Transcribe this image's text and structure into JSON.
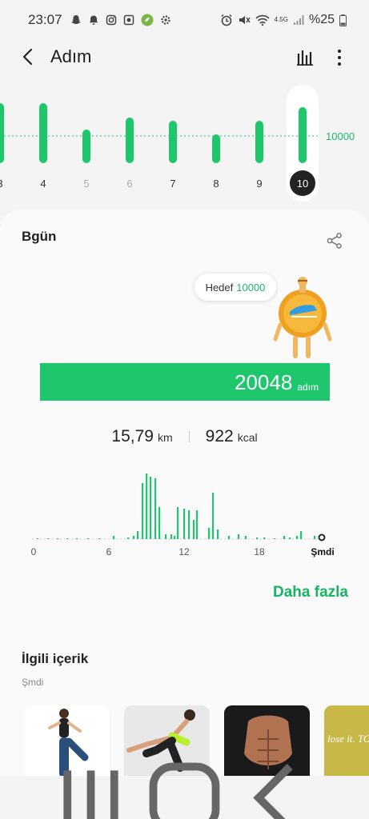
{
  "status_bar": {
    "time": "23:07",
    "battery": "%25",
    "network": "4.5G",
    "icons": [
      "snapchat-icon",
      "notification-bell-icon",
      "instagram-icon",
      "camera-icon",
      "app-icon",
      "settings-gear-icon"
    ],
    "right_icons": [
      "alarm-icon",
      "mute-icon",
      "wifi-icon",
      "signal-icon",
      "battery-icon"
    ]
  },
  "header": {
    "title": "Adım"
  },
  "week_chart": {
    "goal_label": "10000",
    "days": [
      {
        "label": "3",
        "value": 0.75,
        "selected": false,
        "dim": false
      },
      {
        "label": "4",
        "value": 0.75,
        "selected": false,
        "dim": false
      },
      {
        "label": "5",
        "value": 0.42,
        "selected": false,
        "dim": true
      },
      {
        "label": "6",
        "value": 0.57,
        "selected": false,
        "dim": true
      },
      {
        "label": "7",
        "value": 0.53,
        "selected": false,
        "dim": false
      },
      {
        "label": "8",
        "value": 0.36,
        "selected": false,
        "dim": false
      },
      {
        "label": "9",
        "value": 0.53,
        "selected": false,
        "dim": false
      },
      {
        "label": "10",
        "value": 0.7,
        "selected": true,
        "dim": false
      }
    ]
  },
  "today": {
    "title": "Bgün",
    "goal_label": "Hedef",
    "goal_value": "10000",
    "steps": "20048",
    "steps_unit": "adım",
    "distance": "15,79",
    "distance_unit": "km",
    "calories": "922",
    "calories_unit": "kcal",
    "hour_ticks": [
      "0",
      "6",
      "12",
      "18",
      "Şmdi"
    ],
    "more_link": "Daha fazla"
  },
  "related": {
    "title": "İlgili içerik",
    "subtitle": "Şmdi",
    "thumb_text": "lose it. TONE IT."
  },
  "colors": {
    "accent": "#1fc76c",
    "accent_text": "#17b463"
  }
}
